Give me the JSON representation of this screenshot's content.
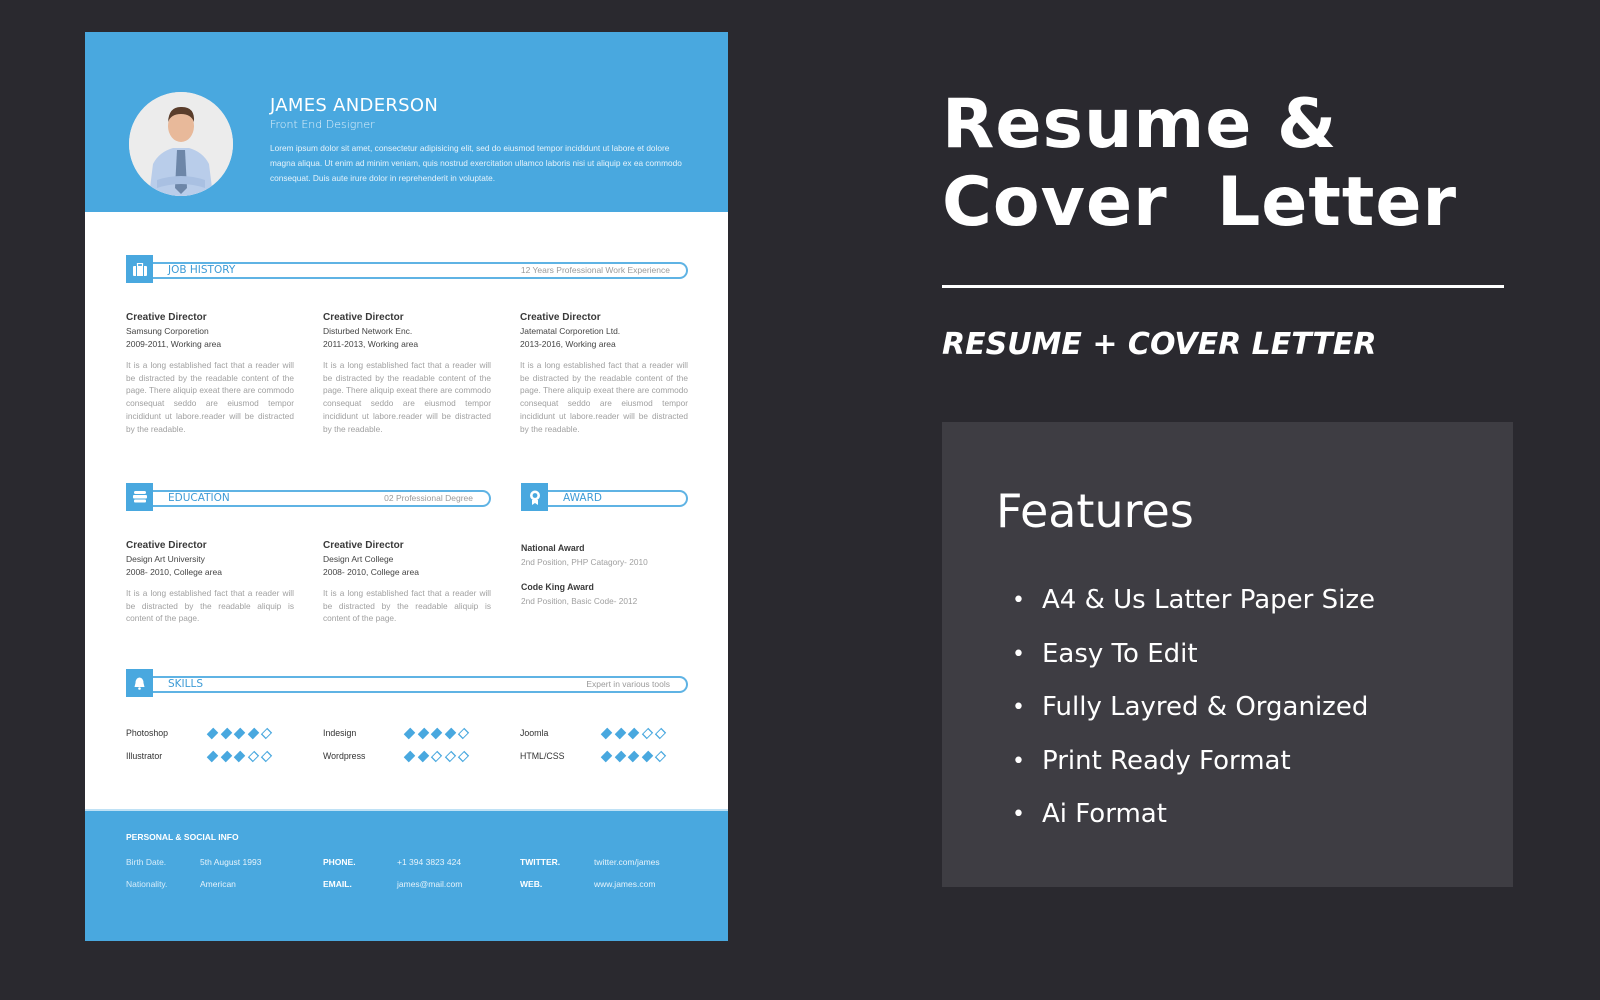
{
  "resume": {
    "header": {
      "name": "JAMES ANDERSON",
      "role": "Front End Designer",
      "intro": "Lorem ipsum dolor sit amet, consectetur adipisicing elit, sed do eiusmod tempor incididunt ut labore et dolore magna aliqua. Ut enim ad minim veniam, quis nostrud exercitation ullamco laboris nisi ut aliquip ex ea commodo consequat. Duis aute irure dolor in reprehenderit in voluptate."
    },
    "job_history": {
      "title": "JOB HISTORY",
      "subtitle": "12 Years Professional Work Experience",
      "icon": "briefcase-icon",
      "items": [
        {
          "title": "Creative Director",
          "company": "Samsung Corporetion",
          "dates": "2009-2011, Working area",
          "desc": "It is a long established fact that a reader will be distracted by the readable content of the page. There aliquip exeat there are commodo consequat seddo are eiusmod tempor incididunt ut labore.reader will be distracted by the readable."
        },
        {
          "title": "Creative Director",
          "company": "Disturbed Network Enc.",
          "dates": "2011-2013, Working area",
          "desc": "It is a long established fact that a reader will be distracted by the readable content of the page. There aliquip exeat there are commodo consequat seddo are eiusmod tempor incididunt ut labore.reader will be distracted by the readable."
        },
        {
          "title": "Creative Director",
          "company": "Jatematal Corporetion Ltd.",
          "dates": "2013-2016, Working area",
          "desc": "It is a long established fact that a reader will be distracted by the readable content of the page. There aliquip exeat there are commodo consequat seddo are eiusmod tempor incididunt ut labore.reader will be distracted by the readable."
        }
      ]
    },
    "education": {
      "title": "EDUCATION",
      "subtitle": "02 Professional Degree",
      "icon": "book-stack-icon",
      "items": [
        {
          "title": "Creative Director",
          "school": "Design Art University",
          "dates": "2008- 2010, College area",
          "desc": "It is a long established fact that a reader will be distracted by the readable aliquip is content of the page."
        },
        {
          "title": "Creative Director",
          "school": "Design Art College",
          "dates": "2008- 2010, College area",
          "desc": "It is a long established fact that a reader will be distracted by the readable aliquip is content of the page."
        }
      ]
    },
    "award": {
      "title": "AWARD",
      "icon": "medal-icon",
      "items": [
        {
          "title": "National Award",
          "desc": "2nd Position, PHP Catagory- 2010"
        },
        {
          "title": "Code King Award",
          "desc": "2nd Position, Basic Code- 2012"
        }
      ]
    },
    "skills": {
      "title": "SKILLS",
      "subtitle": "Expert in various tools",
      "icon": "bell-icon",
      "max": 5,
      "items": [
        {
          "name": "Photoshop",
          "level": 4
        },
        {
          "name": "Indesign",
          "level": 4
        },
        {
          "name": "Joomla",
          "level": 3
        },
        {
          "name": "Illustrator",
          "level": 3
        },
        {
          "name": "Wordpress",
          "level": 2
        },
        {
          "name": "HTML/CSS",
          "level": 4
        }
      ]
    },
    "footer": {
      "title": "PERSONAL & SOCIAL INFO",
      "birth_label": "Birth Date.",
      "birth_value": "5th August 1993",
      "nationality_label": "Nationality.",
      "nationality_value": "American",
      "phone_label": "PHONE.",
      "phone_value": "+1 394 3823 424",
      "email_label": "EMAIL.",
      "email_value": "james@mail.com",
      "twitter_label": "TWITTER.",
      "twitter_value": "twitter.com/james",
      "web_label": "WEB.",
      "web_value": "www.james.com"
    }
  },
  "promo": {
    "title_line1": "Resume &",
    "title_line2": "Cover  Letter",
    "subtitle": "RESUME + COVER LETTER",
    "features_title": "Features",
    "features": [
      "A4 & Us Latter Paper Size",
      "Easy To Edit",
      "Fully Layred & Organized",
      "Print Ready Format",
      "Ai Format"
    ]
  },
  "colors": {
    "background": "#2a292f",
    "accent": "#49a8df",
    "features_panel": "#3e3d43"
  }
}
